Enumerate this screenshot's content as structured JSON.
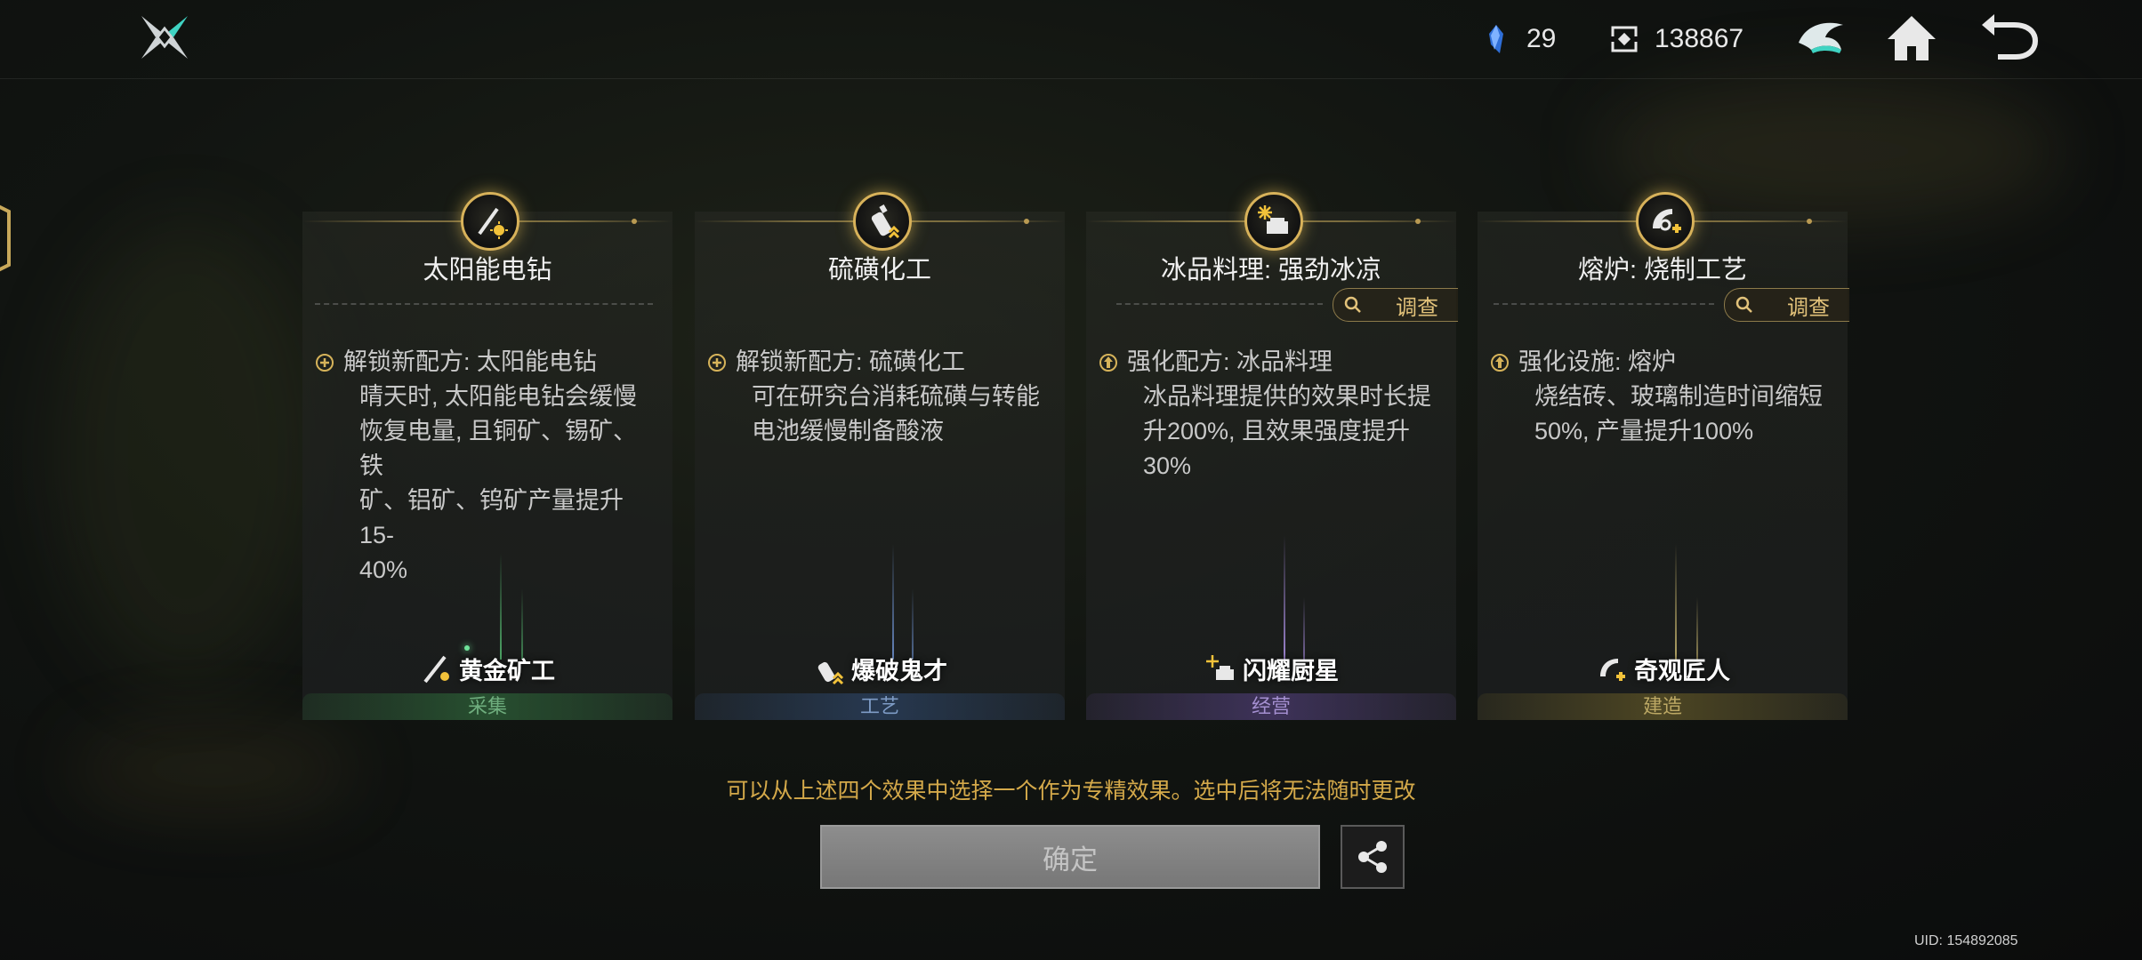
{
  "topbar": {
    "logo_icon": "shuriken-logo-icon",
    "resources": [
      {
        "icon": "crystal-shard-icon",
        "value": "29"
      },
      {
        "icon": "currency-chip-icon",
        "value": "138867"
      }
    ],
    "icons": [
      "guild-emblem-icon",
      "home-icon",
      "back-arrow-icon"
    ]
  },
  "cards": [
    {
      "title": "太阳能电钻",
      "emblem_icon": "solar-drill-icon",
      "has_investigate": false,
      "bullet_icon": "plus-circle-icon",
      "effect_head": "解锁新配方: 太阳能电钻",
      "effect_lines": [
        "晴天时, 太阳能电钻会缓慢",
        "恢复电量, 且铜矿、锡矿、铁",
        "矿、铝矿、钨矿产量提升15-",
        "40%"
      ],
      "role_icon": "miner-pick-icon",
      "role_name": "黄金矿工",
      "category": "采集",
      "accent": "#2e6a3a"
    },
    {
      "title": "硫磺化工",
      "emblem_icon": "chemical-bottle-icon",
      "has_investigate": false,
      "bullet_icon": "plus-circle-icon",
      "effect_head": "解锁新配方: 硫磺化工",
      "effect_lines": [
        "可在研究台消耗硫磺与转能",
        "电池缓慢制备酸液"
      ],
      "role_icon": "explosive-bottle-icon",
      "role_name": "爆破鬼才",
      "category": "工艺",
      "accent": "#2c4466"
    },
    {
      "title": "冰品料理: 强劲冰凉",
      "emblem_icon": "ice-dessert-icon",
      "has_investigate": true,
      "investigate_label": "调查",
      "bullet_icon": "upgrade-arrow-icon",
      "effect_head": "强化配方: 冰品料理",
      "effect_lines": [
        "冰品料理提供的效果时长提",
        "升200%, 且效果强度提升",
        "30%"
      ],
      "role_icon": "chef-star-icon",
      "role_name": "闪耀厨星",
      "category": "经营",
      "accent": "#4a3a6e"
    },
    {
      "title": "熔炉: 烧制工艺",
      "emblem_icon": "furnace-tool-icon",
      "has_investigate": true,
      "investigate_label": "调查",
      "bullet_icon": "upgrade-arrow-icon",
      "effect_head": "强化设施: 熔炉",
      "effect_lines": [
        "烧结砖、玻璃制造时间缩短",
        "50%, 产量提升100%"
      ],
      "role_icon": "craftsman-icon",
      "role_name": "奇观匠人",
      "category": "建造",
      "accent": "#5e5426"
    }
  ],
  "hint": "可以从上述四个效果中选择一个作为专精效果。选中后将无法随时更改",
  "confirm_label": "确定",
  "share_icon": "share-icon",
  "uid": "UID: 154892085"
}
